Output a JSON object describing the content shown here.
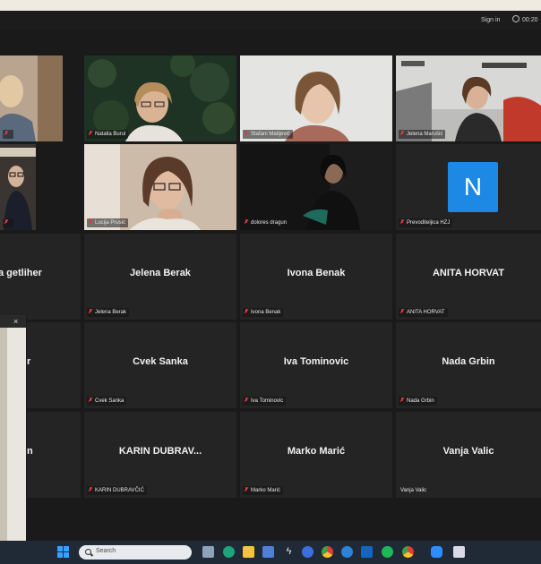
{
  "window": {
    "signin_label": "Sign in",
    "timer": "00:20"
  },
  "participants": [
    {
      "name": "",
      "muted": true
    },
    {
      "name": "Natalia Burul",
      "muted": true
    },
    {
      "name": "Stafani Matijević",
      "muted": true
    },
    {
      "name": "Jelena Marušić",
      "muted": true
    },
    {
      "name": "",
      "muted": true
    },
    {
      "name": "Lucija Prusić",
      "muted": true
    },
    {
      "name": "dolores dragun",
      "muted": true
    },
    {
      "name": "Prevoditeljica HZJ",
      "muted": true,
      "avatar_letter": "N"
    },
    {
      "display": "a getliher",
      "name": "",
      "muted": true
    },
    {
      "display": "Jelena Berak",
      "name": "Jelena Berak",
      "muted": true
    },
    {
      "display": "Ivona Benak",
      "name": "Ivona Benak",
      "muted": true
    },
    {
      "display": "ANITA HORVAT",
      "name": "ANITA HORVAT",
      "muted": true
    },
    {
      "display": "r",
      "name": "",
      "muted": true
    },
    {
      "display": "Cvek Sanka",
      "name": "Cvek Sanka",
      "muted": true
    },
    {
      "display": "Iva Tominovic",
      "name": "Iva Tominovic",
      "muted": true
    },
    {
      "display": "Nada Grbin",
      "name": "Nada Grbin",
      "muted": true
    },
    {
      "display": "n",
      "name": "",
      "muted": true
    },
    {
      "display": "KARIN  DUBRAV...",
      "name": "KARIN DUBRAVČIĆ",
      "muted": true
    },
    {
      "display": "Marko Marić",
      "name": "Marko Marić",
      "muted": true
    },
    {
      "display": "Vanja Valic",
      "name": "Vanja Valic",
      "muted": false
    }
  ],
  "popup": {
    "close_glyph": "×"
  },
  "taskbar": {
    "search_placeholder": "Search"
  },
  "colors": {
    "accent": "#1e88e5",
    "mic_muted": "#e5393b"
  }
}
